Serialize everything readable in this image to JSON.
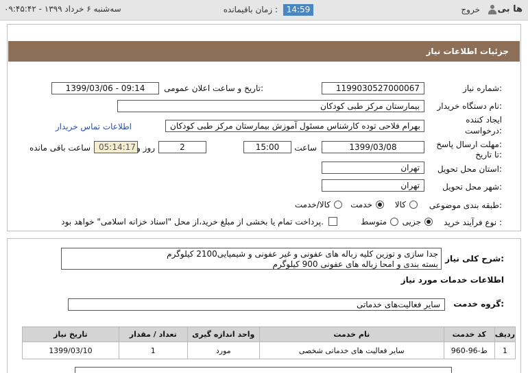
{
  "topbar": {
    "logo": "ها بی",
    "exit": "خروج",
    "remaining_label": "زمان باقیمانده :",
    "remaining_value": "14:59",
    "datetime": "سه‌شنبه ۶ خرداد ۱۳۹۹  - ۰۹:۴۵:۴۲"
  },
  "panel": {
    "title": "جزئیات اطلاعات نیاز",
    "need_number_label": "شماره نیاز:",
    "need_number": "1199030527000067",
    "announce_label": "تاریخ و ساعت اعلان عمومی:",
    "announce_value": "1399/03/06 - 09:14",
    "buyer_label": "نام دستگاه خریدار:",
    "buyer_value": "بیمارستان مرکز طبی کودکان",
    "creator_label_1": "ایجاد کننده",
    "creator_label_2": "درخواست:",
    "creator_value": "بهرام فلاحی توده کارشناس مسئول آموزش بیمارستان مرکز طبی کودکان",
    "contact_link": "اطلاعات تماس خریدار",
    "deadline_label_1": "مهلت ارسال پاسخ:",
    "deadline_label_2": "تا تاریخ:",
    "deadline_date": "1399/03/08",
    "time_label": "ساعت",
    "deadline_time": "15:00",
    "days_value": "2",
    "days_label": "روز و",
    "countdown": "05:14:17",
    "remaining_label": "ساعت باقی مانده",
    "province_label": "استان محل تحویل:",
    "province_value": "تهران",
    "city_label": "شهر محل تحویل:",
    "city_value": "تهران",
    "category_label": "طبقه بندی موضوعی:",
    "category_options": [
      "کالا",
      "خدمت",
      "کالا/خدمت"
    ],
    "category_selected": "خدمت",
    "process_label": "نوع فرآیند خرید :",
    "process_options": [
      "جزیی",
      "متوسط"
    ],
    "process_selected": "جزیی",
    "payment_note": "پرداخت تمام یا بخشی از مبلغ خرید،از محل \"اسناد خزانه اسلامی\" خواهد بود."
  },
  "description": {
    "label": "شرح کلی نیاز:",
    "line1": "جدا سازی و توزین کلیه زباله های عفونی و غیر عفونی و شیمیایی2100 کیلوگرم",
    "line2": "بسته بندی و امحا زباله های عفونی 900 کیلوگرم",
    "services_heading": "اطلاعات خدمات مورد نیاز",
    "group_label": "گروه خدمت:",
    "group_value": "سایر فعالیت‌های خدماتی"
  },
  "table": {
    "headers": [
      "ردیف",
      "کد خدمت",
      "نام خدمت",
      "واحد اندازه گیری",
      "تعداد / مقدار",
      "تاریخ نیاز"
    ],
    "rows": [
      [
        "1",
        "ط-96-960",
        "سایر فعالیت های خدماتی شخصی",
        "مورد",
        "1",
        "1399/03/10"
      ]
    ]
  }
}
